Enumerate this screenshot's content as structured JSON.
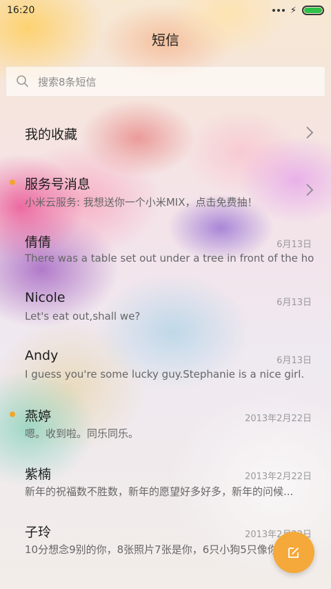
{
  "status_bar": {
    "time": "16:20"
  },
  "header": {
    "title": "短信"
  },
  "search": {
    "placeholder": "搜索8条短信"
  },
  "favorites": {
    "label": "我的收藏"
  },
  "conversations": [
    {
      "name": "服务号消息",
      "snippet": "小米云服务: 我想送你一个小米MIX，点击免费抽！",
      "date": "",
      "unread": true,
      "has_chevron": true
    },
    {
      "name": "倩倩",
      "snippet": "There was a table set out under a tree in front of the ho...",
      "date": "6月13日",
      "unread": false
    },
    {
      "name": "Nicole",
      "snippet": "Let's eat out,shall we?",
      "date": "6月13日",
      "unread": false
    },
    {
      "name": "Andy",
      "snippet": "I guess you're some lucky guy.Stephanie is a nice girl.",
      "date": "6月13日",
      "unread": false
    },
    {
      "name": "燕婷",
      "snippet": "嗯。收到啦。同乐同乐。",
      "date": "2013年2月22日",
      "unread": true
    },
    {
      "name": "紫楠",
      "snippet": "新年的祝福数不胜数，新年的愿望好多好多，新年的问候...",
      "date": "2013年2月22日",
      "unread": false
    },
    {
      "name": "子玲",
      "snippet": "10分想念9别的你，8张照片7张是你，6只小狗5只像你...",
      "date": "2013年2月22日",
      "unread": false
    }
  ],
  "colors": {
    "accent": "#f5a93a",
    "unread_dot": "#f2a52a",
    "battery": "#2ec24a"
  },
  "icons": {
    "search": "search-icon",
    "compose": "compose-icon",
    "chevron": "chevron-right-icon"
  }
}
